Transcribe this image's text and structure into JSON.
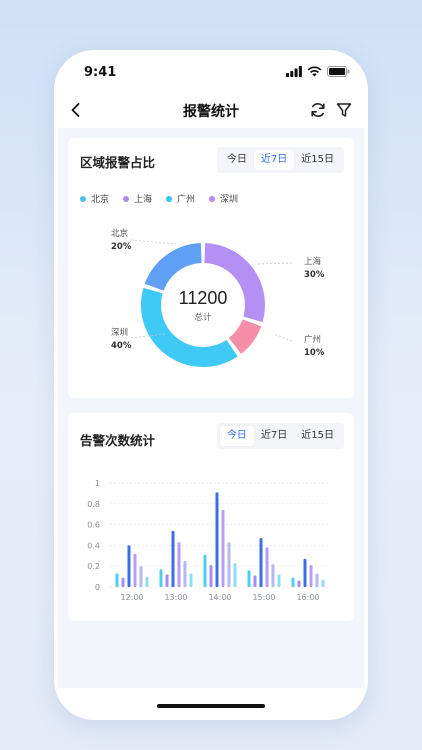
{
  "status": {
    "time": "9:41"
  },
  "nav": {
    "title": "报警统计"
  },
  "card1": {
    "title": "区域报警占比",
    "tabs": [
      "今日",
      "近7日",
      "近15日"
    ],
    "active_tab": 1,
    "legend": [
      {
        "label": "北京",
        "color": "#48c2f0"
      },
      {
        "label": "上海",
        "color": "#a98bf2"
      },
      {
        "label": "广州",
        "color": "#2ec7f0"
      },
      {
        "label": "深圳",
        "color": "#b78af0"
      }
    ],
    "total_value": "11200",
    "total_label": "总计",
    "callouts": {
      "beijing": {
        "name": "北京",
        "pct": "20%"
      },
      "shanghai": {
        "name": "上海",
        "pct": "30%"
      },
      "guangzhou": {
        "name": "广州",
        "pct": "10%"
      },
      "shenzhen": {
        "name": "深圳",
        "pct": "40%"
      }
    }
  },
  "card2": {
    "title": "告警次数统计",
    "tabs": [
      "今日",
      "近7日",
      "近15日"
    ],
    "active_tab": 0
  },
  "colors": {
    "accent": "#2f6fe8",
    "beijing": "#5f9ff6",
    "shanghai": "#b490f5",
    "guangzhou": "#f58fa8",
    "shenzhen": "#3fc9f5"
  },
  "chart_data": [
    {
      "type": "pie",
      "categories": [
        "北京",
        "上海",
        "广州",
        "深圳"
      ],
      "values": [
        20,
        30,
        10,
        40
      ],
      "total": 11200
    },
    {
      "type": "bar",
      "categories": [
        "12:00",
        "13:00",
        "14:00",
        "15:00",
        "16:00"
      ],
      "ylim": [
        0,
        1
      ],
      "yticks": [
        "0",
        "0.2",
        "0.4",
        "0.6",
        "0.8",
        "1"
      ],
      "series": [
        {
          "values": [
            0.13,
            0.17,
            0.31,
            0.16,
            0.09
          ],
          "color": "#4fcbf2"
        },
        {
          "values": [
            0.09,
            0.12,
            0.21,
            0.11,
            0.06
          ],
          "color": "#a78bf5"
        },
        {
          "values": [
            0.4,
            0.54,
            0.91,
            0.47,
            0.27
          ],
          "color": "#3b6fe3"
        },
        {
          "values": [
            0.32,
            0.43,
            0.74,
            0.38,
            0.21
          ],
          "color": "#b79cf6"
        },
        {
          "values": [
            0.2,
            0.25,
            0.43,
            0.22,
            0.13
          ],
          "color": "#b6b9ef"
        },
        {
          "values": [
            0.1,
            0.13,
            0.23,
            0.12,
            0.07
          ],
          "color": "#8fdff2"
        }
      ]
    }
  ]
}
